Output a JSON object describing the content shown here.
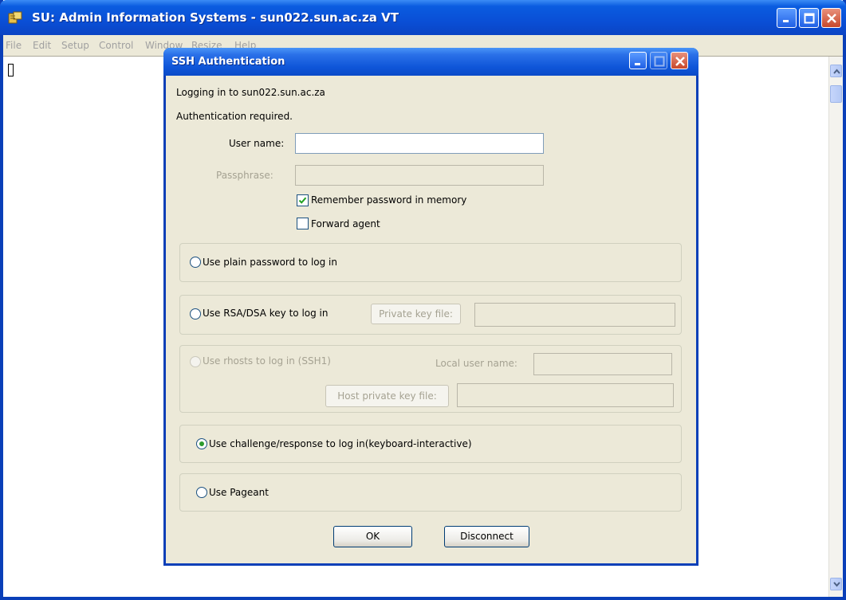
{
  "main_window": {
    "title": "SU: Admin Information Systems - sun022.sun.ac.za VT",
    "menu": [
      "File",
      "Edit",
      "Setup",
      "Control",
      "Window",
      "Resize",
      "Help"
    ]
  },
  "dialog": {
    "title": "SSH Authentication",
    "logging_in": "Logging in to sun022.sun.ac.za",
    "auth_required": "Authentication required.",
    "username_label": "User name:",
    "username_value": "",
    "passphrase_label": "Passphrase:",
    "remember_password": "Remember password in memory",
    "remember_checked": true,
    "forward_agent": "Forward agent",
    "forward_checked": false,
    "options": {
      "plain": "Use plain password to log in",
      "rsa": "Use RSA/DSA key to log in",
      "private_key_btn": "Private key file:",
      "rhosts": "Use rhosts to log in (SSH1)",
      "local_user": "Local user name:",
      "host_key_btn": "Host private key file:",
      "challenge": "Use challenge/response to log in(keyboard-interactive)",
      "pageant": "Use Pageant"
    },
    "selected_option": "challenge",
    "ok": "OK",
    "disconnect": "Disconnect"
  }
}
